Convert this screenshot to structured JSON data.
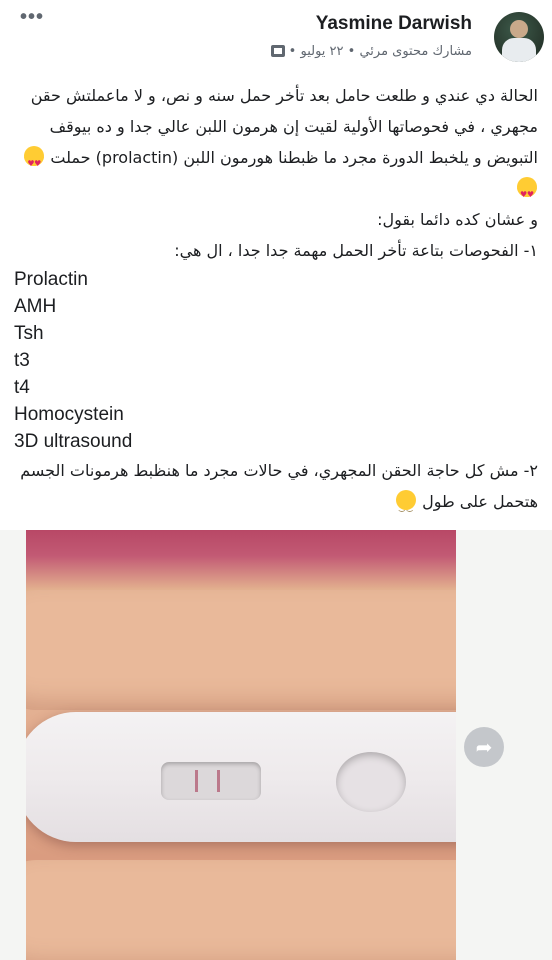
{
  "header": {
    "more_label": "•••",
    "author_name": "Yasmine Darwish",
    "meta_text": "مشارك محتوى مرئي • ٢٢ يوليو •",
    "avatar_icon": "profile-photo",
    "privacy_icon": "group-privacy-icon"
  },
  "post": {
    "paragraph_1": "الحالة دي عندي و طلعت حامل بعد تأخر حمل سنه و نص، و لا ماعملتش حقن مجهري ، في فحوصاتها الأولية لقيت إن هرمون اللبن عالي جدا و ده بيوقف التبويض و يلخبط الدورة مجرد ما ظبطنا هورمون اللبن (prolactin) حملت",
    "line_2": "و عشان كده دائما بقول:",
    "line_3": "١- الفحوصات بتاعة تأخر الحمل مهمة جدا جدا ، ال هي:",
    "tests": [
      "Prolactin",
      "AMH",
      "Tsh",
      "t3",
      "t4",
      "Homocystein",
      "3D ultrasound"
    ],
    "paragraph_4": "٢- مش كل حاجة الحقن المجهري، في حالات مجرد ما هنظبط هرمونات الجسم هتحمل على طول"
  },
  "photo": {
    "description_icon": "pregnancy-test-photo",
    "share_icon": "share-arrow-icon",
    "share_glyph": "➦"
  }
}
